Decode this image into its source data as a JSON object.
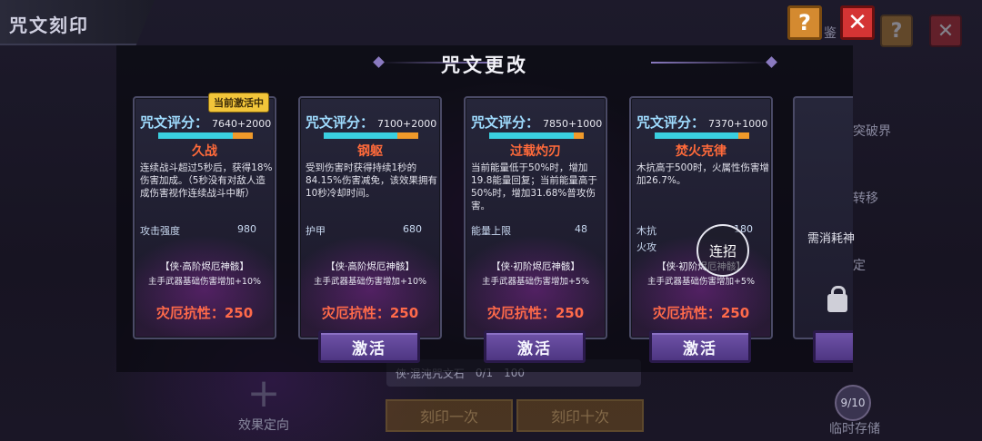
{
  "background": {
    "title": "咒文刻印",
    "jian_label": "鉴",
    "break_label": "突破界",
    "transfer_label": "转移",
    "fix_label": "定",
    "effect_direction": "效果定向",
    "item_name": "侠·混沌咒文石",
    "item_count": "0/1",
    "item_cost": "100",
    "engrave_once": "刻印一次",
    "engrave_ten": "刻印十次",
    "storage_count": "9/10",
    "temp_storage": "临时存储"
  },
  "modal": {
    "title": "咒文更改",
    "help_symbol": "?",
    "close_symbol": "✕"
  },
  "cards": [
    {
      "badge": "当前激活中",
      "score_label": "咒文评分：",
      "score_value": "7640+2000",
      "score_fraction": 0.79,
      "bonus_fraction": 0.21,
      "name": "久战",
      "desc": "连续战斗超过5秒后，获得18%伤害加成。（5秒没有对敌人造成伤害视作连续战斗中断）",
      "stats": [
        {
          "label": "攻击强度",
          "value": "980"
        }
      ],
      "divine_name": "【侠·高阶烬厄神骸】",
      "divine_bonus": "主手武器基础伤害增加+10%",
      "disaster": "灾厄抗性：250",
      "button": ""
    },
    {
      "badge": "",
      "score_label": "咒文评分：",
      "score_value": "7100+2000",
      "score_fraction": 0.78,
      "bonus_fraction": 0.22,
      "name": "钢躯",
      "desc": "受到伤害时获得持续1秒的84.15%伤害减免，该效果拥有10秒冷却时间。",
      "stats": [
        {
          "label": "护甲",
          "value": "680"
        }
      ],
      "divine_name": "【侠·高阶烬厄神骸】",
      "divine_bonus": "主手武器基础伤害增加+10%",
      "disaster": "灾厄抗性：250",
      "button": "激活"
    },
    {
      "badge": "",
      "score_label": "咒文评分：",
      "score_value": "7850+1000",
      "score_fraction": 0.89,
      "bonus_fraction": 0.11,
      "name": "过载灼刃",
      "desc": "当前能量低于50%时，增加19.8能量回复；当前能量高于50%时，增加31.68%普攻伤害。",
      "stats": [
        {
          "label": "能量上限",
          "value": "48"
        }
      ],
      "divine_name": "【侠·初阶烬厄神骸】",
      "divine_bonus": "主手武器基础伤害增加+5%",
      "disaster": "灾厄抗性：250",
      "button": "激活"
    },
    {
      "badge": "",
      "score_label": "咒文评分：",
      "score_value": "7370+1000",
      "score_fraction": 0.88,
      "bonus_fraction": 0.12,
      "name": "焚火克律",
      "desc": "木抗高于500时，火属性伤害增加26.7%。",
      "stats": [
        {
          "label": "木抗",
          "value": "180"
        },
        {
          "label": "火攻",
          "value": ""
        }
      ],
      "divine_name": "【侠·初阶烬厄神骸】",
      "divine_bonus": "主手武器基础伤害增加+5%",
      "disaster": "灾厄抗性：250",
      "button": "激活"
    }
  ],
  "card5": {
    "text": "需消耗神"
  },
  "combo_tip": "连招"
}
